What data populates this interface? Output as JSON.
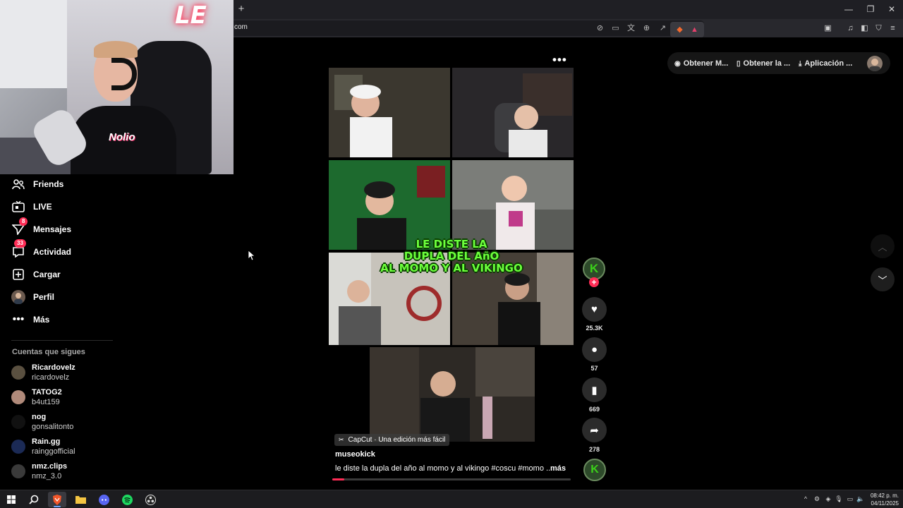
{
  "browser": {
    "url": "com",
    "new_tab": "+",
    "window_controls": {
      "minimize": "—",
      "restore": "❐",
      "close": "✕"
    },
    "toolbar_icons": [
      "no-sound-icon",
      "cast-icon",
      "translate-icon",
      "zoom-icon",
      "share-icon",
      "brave-shields-icon",
      "brave-rewards-icon",
      "bookmark-manager-icon",
      "media-icon",
      "sidebar-icon",
      "vpn-icon",
      "menu-icon"
    ]
  },
  "webcam": {
    "neon_sign": "LE",
    "shirt_logo": "Nolio"
  },
  "nav": {
    "items": [
      {
        "label": "Friends",
        "icon": "friends-icon"
      },
      {
        "label": "LIVE",
        "icon": "live-icon"
      },
      {
        "label": "Mensajes",
        "icon": "messages-icon",
        "badge": "8"
      },
      {
        "label": "Actividad",
        "icon": "activity-icon",
        "badge": "33"
      },
      {
        "label": "Cargar",
        "icon": "upload-icon"
      },
      {
        "label": "Perfil",
        "icon": "profile-avatar"
      },
      {
        "label": "Más",
        "icon": "more-icon"
      }
    ],
    "following_heading": "Cuentas que sigues",
    "following": [
      {
        "name": "Ricardovelz",
        "handle": "ricardovelz"
      },
      {
        "name": "TATOG2",
        "handle": "b4ut159"
      },
      {
        "name": "nog",
        "handle": "gonsalitonto"
      },
      {
        "name": "Rain.gg",
        "handle": "rainggofficial"
      },
      {
        "name": "nmz.clips",
        "handle": "nmz_3.0"
      }
    ]
  },
  "video": {
    "overlay_text_lines": [
      "LE DISTE LA",
      "DUPLA DEL AñO",
      "AL MOMO Y AL VIKINGO"
    ],
    "more_menu": "•••",
    "capcut_label": "CapCut · Una edición más fácil",
    "username": "museokick",
    "description": "le diste la dupla del año al momo y al vikingo #coscu #momo ...",
    "more_link": "más",
    "progress": 0.05
  },
  "actions": {
    "likes": "25.3K",
    "comments": "57",
    "saves": "669",
    "shares": "278",
    "avatar_letter": "K",
    "follow_plus": "+"
  },
  "top_pill": {
    "items": [
      {
        "label": "Obtener M...",
        "icon": "coin-icon"
      },
      {
        "label": "Obtener la ...",
        "icon": "phone-icon"
      },
      {
        "label": "Aplicación ...",
        "icon": "download-icon"
      }
    ]
  },
  "navigation": {
    "up": "︿",
    "down": "﹀"
  },
  "taskbar": {
    "time": "08:42 p. m.",
    "date": "04/11/2025",
    "apps": [
      "windows-start-icon",
      "search-icon",
      "brave-browser-icon",
      "file-explorer-icon",
      "discord-icon",
      "spotify-icon",
      "obs-icon"
    ]
  },
  "colors": {
    "accent": "#fe2c55",
    "overlay_green": "#6cff3c",
    "background": "#000000"
  }
}
